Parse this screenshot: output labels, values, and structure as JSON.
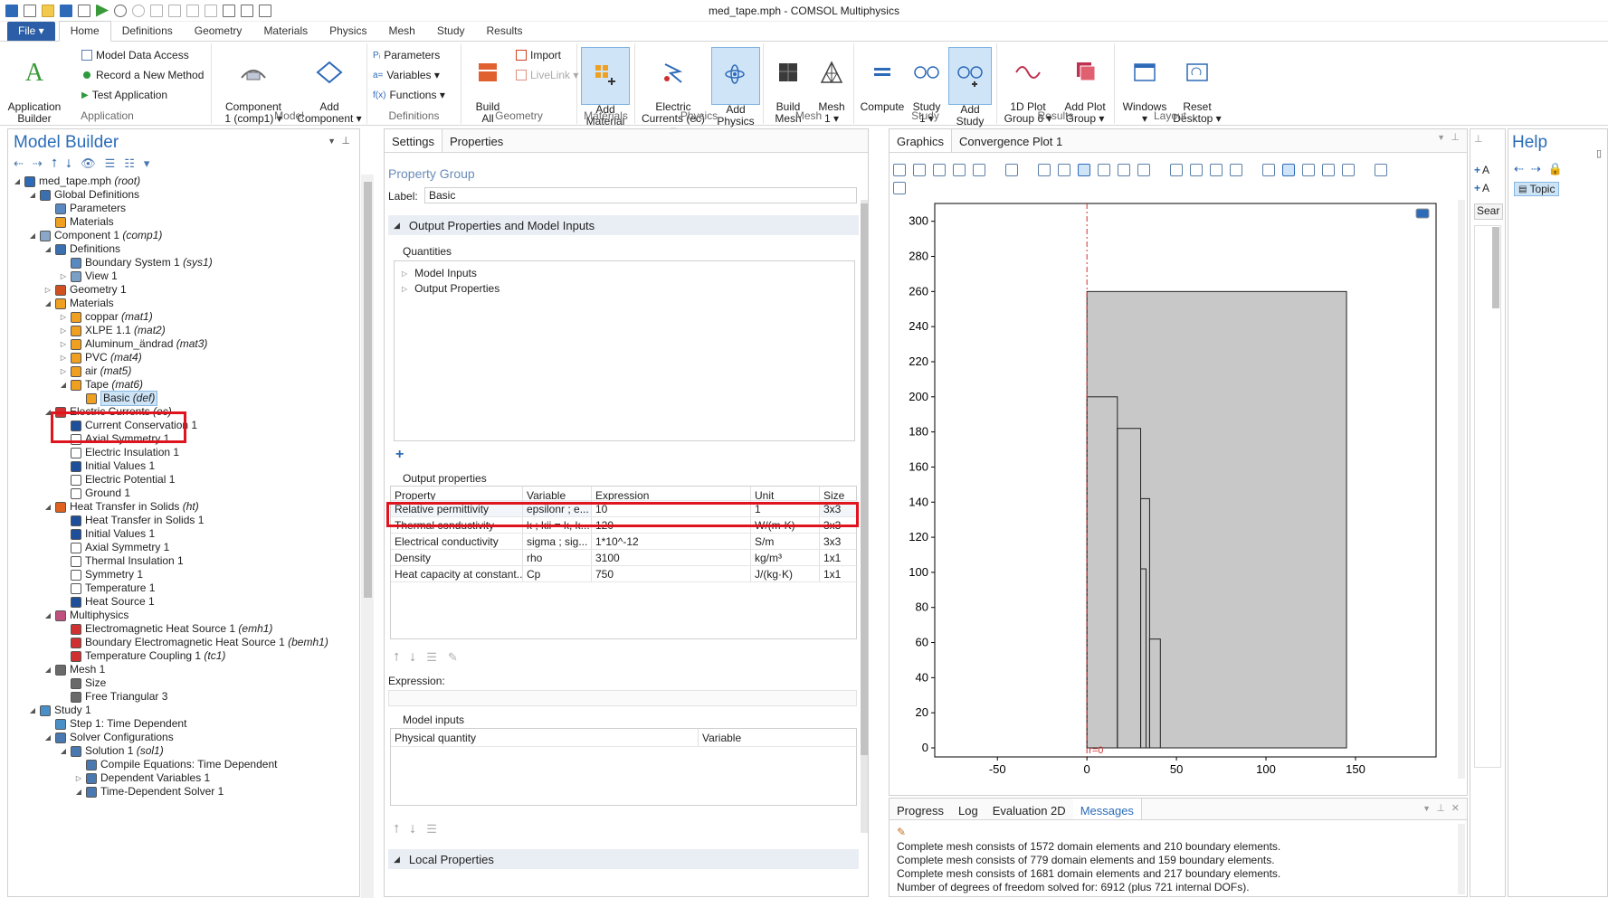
{
  "window": {
    "title": "med_tape.mph - COMSOL Multiphysics"
  },
  "ribbon_tabs": [
    "File ▾",
    "Home",
    "Definitions",
    "Geometry",
    "Materials",
    "Physics",
    "Mesh",
    "Study",
    "Results"
  ],
  "ribbon": {
    "application": {
      "group": "Application",
      "app_builder": "Application\nBuilder",
      "model_data_access": "Model Data Access",
      "record_method": "Record a New Method",
      "test_app": "Test Application"
    },
    "model": {
      "group": "Model",
      "component": "Component\n1 (comp1) ▾",
      "add_component": "Add\nComponent ▾"
    },
    "definitions": {
      "group": "Definitions",
      "parameters": "Parameters",
      "variables": "Variables ▾",
      "functions": "Functions ▾"
    },
    "geometry": {
      "group": "Geometry",
      "build_all": "Build\nAll",
      "import": "Import",
      "livelink": "LiveLink ▾"
    },
    "materials": {
      "group": "Materials",
      "add_material": "Add\nMaterial"
    },
    "physics": {
      "group": "Physics",
      "electric_currents": "Electric\nCurrents (ec) ▾",
      "add_physics": "Add\nPhysics"
    },
    "mesh": {
      "group": "Mesh",
      "build_mesh": "Build\nMesh",
      "mesh1": "Mesh\n1 ▾"
    },
    "study": {
      "group": "Study",
      "compute": "Compute",
      "study1": "Study\n1 ▾",
      "add_study": "Add\nStudy"
    },
    "results": {
      "group": "Results",
      "plot1d": "1D Plot\nGroup 6 ▾",
      "add_plot": "Add Plot\nGroup ▾"
    },
    "layout": {
      "group": "Layout",
      "windows": "Windows\n▾",
      "reset": "Reset\nDesktop ▾"
    }
  },
  "model_builder": {
    "title": "Model Builder",
    "tree": [
      {
        "d": 0,
        "w": "◢",
        "label": "med_tape.mph",
        "tag": "(root)",
        "ic": "#2d6ab8"
      },
      {
        "d": 1,
        "w": "◢",
        "label": "Global Definitions",
        "tag": "",
        "ic": "#3a6fb0"
      },
      {
        "d": 2,
        "w": "",
        "label": "Parameters",
        "tag": "",
        "ic": "#5a88c0"
      },
      {
        "d": 2,
        "w": "",
        "label": "Materials",
        "tag": "",
        "ic": "#f0a020"
      },
      {
        "d": 1,
        "w": "◢",
        "label": "Component 1",
        "tag": "(comp1)",
        "ic": "#8aa6c8"
      },
      {
        "d": 2,
        "w": "◢",
        "label": "Definitions",
        "tag": "",
        "ic": "#3a6fb0"
      },
      {
        "d": 3,
        "w": "",
        "label": "Boundary System 1",
        "tag": "(sys1)",
        "ic": "#5a88c0"
      },
      {
        "d": 3,
        "w": "▷",
        "label": "View 1",
        "tag": "",
        "ic": "#7aa0c8"
      },
      {
        "d": 2,
        "w": "▷",
        "label": "Geometry 1",
        "tag": "",
        "ic": "#d05020"
      },
      {
        "d": 2,
        "w": "◢",
        "label": "Materials",
        "tag": "",
        "ic": "#f0a020"
      },
      {
        "d": 3,
        "w": "▷",
        "label": "coppar",
        "tag": "(mat1)",
        "ic": "#f0a020"
      },
      {
        "d": 3,
        "w": "▷",
        "label": "XLPE 1.1",
        "tag": "(mat2)",
        "ic": "#f0a020"
      },
      {
        "d": 3,
        "w": "▷",
        "label": "Aluminum_ändrad",
        "tag": "(mat3)",
        "ic": "#f0a020"
      },
      {
        "d": 3,
        "w": "▷",
        "label": "PVC",
        "tag": "(mat4)",
        "ic": "#f0a020"
      },
      {
        "d": 3,
        "w": "▷",
        "label": "air",
        "tag": "(mat5)",
        "ic": "#f0a020"
      },
      {
        "d": 3,
        "w": "◢",
        "label": "Tape",
        "tag": "(mat6)",
        "ic": "#f0a020"
      },
      {
        "d": 4,
        "w": "",
        "label": "Basic",
        "tag": "(def)",
        "ic": "#f0a020",
        "sel": true
      },
      {
        "d": 2,
        "w": "◢",
        "label": "Electric Currents",
        "tag": "(ec)",
        "ic": "#d03030"
      },
      {
        "d": 3,
        "w": "",
        "label": "Current Conservation 1",
        "tag": "",
        "ic": "#1e4f9a"
      },
      {
        "d": 3,
        "w": "",
        "label": "Axial Symmetry 1",
        "tag": "",
        "ic": "#ffffff"
      },
      {
        "d": 3,
        "w": "",
        "label": "Electric Insulation 1",
        "tag": "",
        "ic": "#ffffff"
      },
      {
        "d": 3,
        "w": "",
        "label": "Initial Values 1",
        "tag": "",
        "ic": "#1e4f9a"
      },
      {
        "d": 3,
        "w": "",
        "label": "Electric Potential 1",
        "tag": "",
        "ic": "#ffffff"
      },
      {
        "d": 3,
        "w": "",
        "label": "Ground 1",
        "tag": "",
        "ic": "#ffffff"
      },
      {
        "d": 2,
        "w": "◢",
        "label": "Heat Transfer in Solids",
        "tag": "(ht)",
        "ic": "#e06020"
      },
      {
        "d": 3,
        "w": "",
        "label": "Heat Transfer in Solids 1",
        "tag": "",
        "ic": "#1e4f9a"
      },
      {
        "d": 3,
        "w": "",
        "label": "Initial Values 1",
        "tag": "",
        "ic": "#1e4f9a"
      },
      {
        "d": 3,
        "w": "",
        "label": "Axial Symmetry 1",
        "tag": "",
        "ic": "#ffffff"
      },
      {
        "d": 3,
        "w": "",
        "label": "Thermal Insulation 1",
        "tag": "",
        "ic": "#ffffff"
      },
      {
        "d": 3,
        "w": "",
        "label": "Symmetry 1",
        "tag": "",
        "ic": "#ffffff"
      },
      {
        "d": 3,
        "w": "",
        "label": "Temperature 1",
        "tag": "",
        "ic": "#ffffff"
      },
      {
        "d": 3,
        "w": "",
        "label": "Heat Source 1",
        "tag": "",
        "ic": "#1e4f9a"
      },
      {
        "d": 2,
        "w": "◢",
        "label": "Multiphysics",
        "tag": "",
        "ic": "#c05080"
      },
      {
        "d": 3,
        "w": "",
        "label": "Electromagnetic Heat Source 1",
        "tag": "(emh1)",
        "ic": "#d03030"
      },
      {
        "d": 3,
        "w": "",
        "label": "Boundary Electromagnetic Heat Source 1",
        "tag": "(bemh1)",
        "ic": "#d03030"
      },
      {
        "d": 3,
        "w": "",
        "label": "Temperature Coupling 1",
        "tag": "(tc1)",
        "ic": "#d03030"
      },
      {
        "d": 2,
        "w": "◢",
        "label": "Mesh 1",
        "tag": "",
        "ic": "#6a6a6a"
      },
      {
        "d": 3,
        "w": "",
        "label": "Size",
        "tag": "",
        "ic": "#6a6a6a"
      },
      {
        "d": 3,
        "w": "",
        "label": "Free Triangular 3",
        "tag": "",
        "ic": "#6a6a6a"
      },
      {
        "d": 1,
        "w": "◢",
        "label": "Study 1",
        "tag": "",
        "ic": "#4a90c8"
      },
      {
        "d": 2,
        "w": "",
        "label": "Step 1: Time Dependent",
        "tag": "",
        "ic": "#4a90c8"
      },
      {
        "d": 2,
        "w": "◢",
        "label": "Solver Configurations",
        "tag": "",
        "ic": "#4a78b0"
      },
      {
        "d": 3,
        "w": "◢",
        "label": "Solution 1",
        "tag": "(sol1)",
        "ic": "#4a78b0"
      },
      {
        "d": 4,
        "w": "",
        "label": "Compile Equations: Time Dependent",
        "tag": "",
        "ic": "#4a78b0"
      },
      {
        "d": 4,
        "w": "▷",
        "label": "Dependent Variables 1",
        "tag": "",
        "ic": "#4a78b0"
      },
      {
        "d": 4,
        "w": "◢",
        "label": "Time-Dependent Solver 1",
        "tag": "",
        "ic": "#4a78b0"
      }
    ]
  },
  "settings": {
    "tabs": [
      "Settings",
      "Properties"
    ],
    "title": "Property Group",
    "label_caption": "Label:",
    "label_value": "Basic",
    "section1": "Output Properties and Model Inputs",
    "quantities": "Quantities",
    "q_items": [
      "Model Inputs",
      "Output Properties"
    ],
    "output_properties": "Output properties",
    "columns": [
      "Property",
      "Variable",
      "Expression",
      "Unit",
      "Size"
    ],
    "rows": [
      [
        "Relative permittivity",
        "epsilonr ; e...",
        "10",
        "1",
        "3x3"
      ],
      [
        "Thermal conductivity",
        "k ; kii = k, k...",
        "120",
        "W/(m·K)",
        "3x3"
      ],
      [
        "Electrical conductivity",
        "sigma ; sig...",
        "1*10^-12",
        "S/m",
        "3x3"
      ],
      [
        "Density",
        "rho",
        "3100",
        "kg/m³",
        "1x1"
      ],
      [
        "Heat capacity at constant...",
        "Cp",
        "750",
        "J/(kg·K)",
        "1x1"
      ]
    ],
    "expression_caption": "Expression:",
    "model_inputs": "Model inputs",
    "mi_columns": [
      "Physical quantity",
      "Variable"
    ],
    "section2": "Local Properties"
  },
  "graphics": {
    "tabs": [
      "Graphics",
      "Convergence Plot 1"
    ],
    "x_ticks": [
      -50,
      0,
      50,
      100,
      150
    ],
    "y_ticks": [
      0,
      20,
      40,
      60,
      80,
      100,
      120,
      140,
      160,
      180,
      200,
      220,
      240,
      260,
      280,
      300
    ],
    "r0_label": "r=0"
  },
  "messages": {
    "tabs": [
      "Progress",
      "Log",
      "Evaluation 2D",
      "Messages"
    ],
    "lines": [
      "Complete mesh consists of 1572 domain elements and 210 boundary elements.",
      "Complete mesh consists of 779 domain elements and 159 boundary elements.",
      "Complete mesh consists of 1681 domain elements and 217 boundary elements.",
      "Number of degrees of freedom solved for: 6912 (plus 721 internal DOFs)."
    ]
  },
  "right": {
    "help_title": "Help",
    "topic": "Topic",
    "search": "Sear",
    "a1": "A",
    "a2": "A"
  }
}
